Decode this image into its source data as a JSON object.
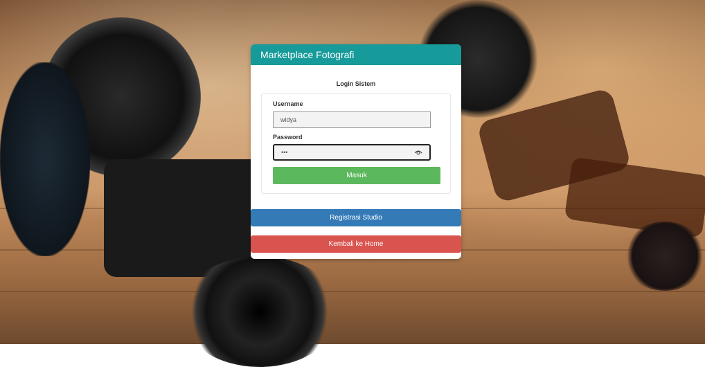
{
  "header": {
    "title": "Marketplace Fotografi"
  },
  "login": {
    "title": "Login Sistem",
    "username_label": "Username",
    "username_value": "widya",
    "password_label": "Password",
    "password_value": "•••",
    "submit_label": "Masuk"
  },
  "actions": {
    "register_label": "Registrasi Studio",
    "home_label": "Kembali ke Home"
  },
  "colors": {
    "header": "#179a9a",
    "submit": "#5cb85c",
    "register": "#337ab7",
    "home": "#d9534f"
  },
  "icons": {
    "password_toggle": "eye-icon"
  }
}
